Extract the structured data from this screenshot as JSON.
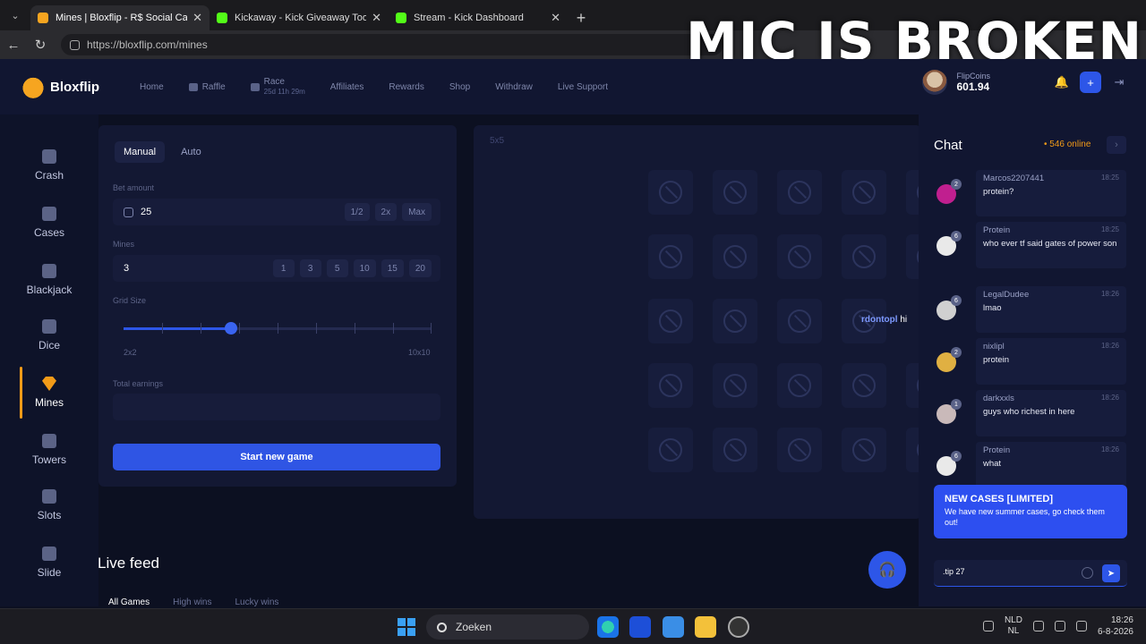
{
  "browser": {
    "tabs": [
      {
        "title": "Mines | Bloxflip - R$ Social Casino",
        "color": "#f6a520",
        "active": true
      },
      {
        "title": "Kickaway - Kick Giveaway Tool",
        "color": "#53fc18",
        "active": false
      },
      {
        "title": "Stream - Kick Dashboard",
        "color": "#53fc18",
        "active": false
      }
    ],
    "url": "https://bloxflip.com/mines"
  },
  "overlay_text": "MIC IS BROKEN",
  "header": {
    "logo": "Bloxflip",
    "nav": [
      "Home",
      "Raffle",
      "Race",
      "Affiliates",
      "Rewards",
      "Shop",
      "Withdraw",
      "Live Support"
    ],
    "race_timer": "25d 11h 29m",
    "coins_label": "FlipCoins",
    "coins_value": "601.94"
  },
  "sidebar": [
    "Crash",
    "Cases",
    "Blackjack",
    "Dice",
    "Mines",
    "Towers",
    "Slots",
    "Slide"
  ],
  "sidebar_active": "Mines",
  "bet": {
    "tabs": [
      "Manual",
      "Auto"
    ],
    "bet_label": "Bet amount",
    "bet_value": "25",
    "bet_chips": [
      "1/2",
      "2x",
      "Max"
    ],
    "mines_label": "Mines",
    "mines_value": "3",
    "mines_chips": [
      "1",
      "3",
      "5",
      "10",
      "15",
      "20"
    ],
    "grid_label": "Grid Size",
    "grid_min": "2x2",
    "grid_max": "10x10",
    "grid_level": 0.35,
    "earnings_label": "Total earnings",
    "start_label": "Start new game"
  },
  "game": {
    "size_label": "5x5",
    "floating_user": "rdontopl",
    "floating_msg": "hi"
  },
  "live_feed": {
    "title": "Live feed",
    "tabs": [
      "All Games",
      "High wins",
      "Lucky wins"
    ]
  },
  "chat": {
    "title": "Chat",
    "online": "• 546 online",
    "messages": [
      {
        "user": "Marcos2207441",
        "time": "18:25",
        "text": "protein?",
        "level": "2",
        "avatar": "#c01f8f"
      },
      {
        "user": "Protein",
        "time": "18:25",
        "text": "who ever tf said gates of power son",
        "level": "6",
        "avatar": "#e9e9e9"
      },
      {
        "user": "LegalDudee",
        "time": "18:26",
        "text": "lmao",
        "level": "6",
        "avatar": "#d0d0d0"
      },
      {
        "user": "nixlipl",
        "time": "18:26",
        "text": "protein",
        "level": "2",
        "avatar": "#e0b042"
      },
      {
        "user": "darkxxls",
        "time": "18:26",
        "text": "guys who richest in here",
        "level": "1",
        "avatar": "#c9b9b9"
      },
      {
        "user": "Protein",
        "time": "18:26",
        "text": "what",
        "level": "6",
        "avatar": "#e9e9e9"
      }
    ],
    "promo_title": "NEW CASES [LIMITED]",
    "promo_body": "We have new summer cases, go check them out!",
    "input_value": ".tip 27"
  },
  "taskbar": {
    "search": "Zoeken",
    "lang1": "NLD",
    "lang2": "NL",
    "time": "18:26",
    "date": "6-8-2026"
  }
}
